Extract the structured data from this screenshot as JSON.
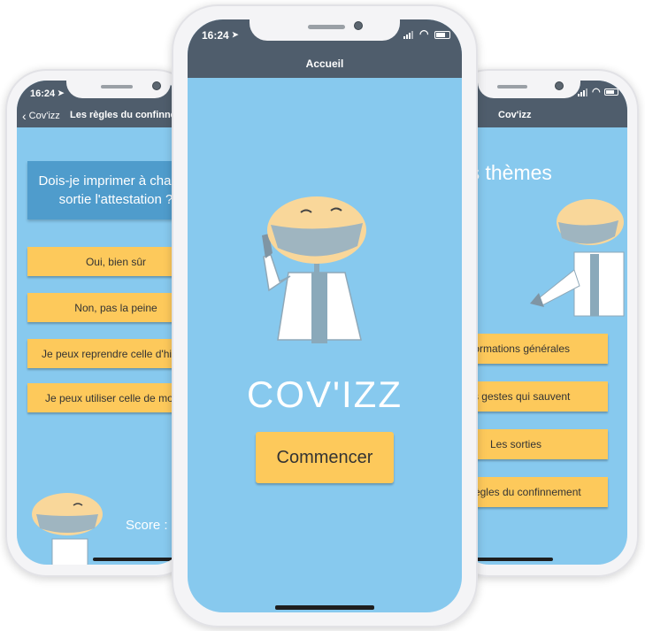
{
  "left_phone": {
    "time": "16:24",
    "back_label": "Cov'izz",
    "nav_title": "Les règles du confinnement",
    "question": "Dois-je imprimer à chaque sortie l'attestation ?",
    "answers": [
      "Oui, bien sûr",
      "Non, pas la peine",
      "Je peux reprendre celle d'hier",
      "Je peux utiliser celle de mon voisin"
    ],
    "score_label": "Score :"
  },
  "center_phone": {
    "time": "16:24",
    "nav_title": "Accueil",
    "app_title": "COV'IZZ",
    "start_button": "Commencer"
  },
  "right_phone": {
    "nav_title": "Cov'izz",
    "heading": "Les thèmes",
    "themes": [
      "Informations générales",
      "Les gestes qui sauvent",
      "Les sorties",
      "Les règles du confinnement"
    ]
  },
  "colors": {
    "screen_bg": "#87c9ee",
    "header_bg": "#4f5d6c",
    "button_bg": "#fdc95b",
    "question_bg": "#4f9ccc"
  }
}
